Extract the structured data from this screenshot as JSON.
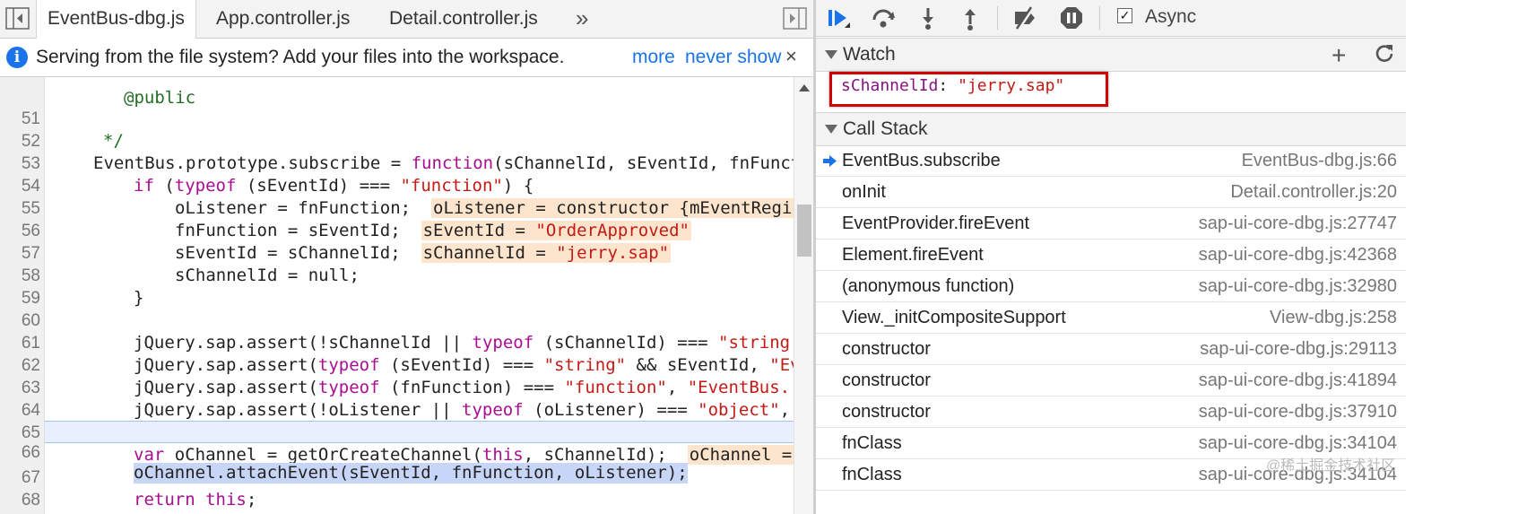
{
  "editor": {
    "tabs": [
      {
        "label": "EventBus-dbg.js",
        "active": true
      },
      {
        "label": "App.controller.js",
        "active": false
      },
      {
        "label": "Detail.controller.js",
        "active": false
      }
    ],
    "more_tabs": "»",
    "infobar": {
      "text": "Serving from the file system? Add your files into the workspace.",
      "link_more": "more",
      "link_never": "never show",
      "close": "×"
    },
    "lines": [
      {
        "n": "51"
      },
      {
        "n": "52"
      },
      {
        "n": "53"
      },
      {
        "n": "54"
      },
      {
        "n": "55"
      },
      {
        "n": "56"
      },
      {
        "n": "57"
      },
      {
        "n": "58"
      },
      {
        "n": "59"
      },
      {
        "n": "60"
      },
      {
        "n": "61"
      },
      {
        "n": "62"
      },
      {
        "n": "63"
      },
      {
        "n": "64"
      },
      {
        "n": "65"
      },
      {
        "n": "66"
      },
      {
        "n": "67"
      },
      {
        "n": "68"
      }
    ],
    "code": {
      "l50_partial": "@public",
      "l51": "*/",
      "l52_a": "EventBus.prototype.subscribe = ",
      "l52_kw": "function",
      "l52_b": "(sChannelId, sEventId, fnFunct",
      "l53_kw1": "if",
      "l53_a": " (",
      "l53_kw2": "typeof",
      "l53_b": " (sEventId) === ",
      "l53_str": "\"function\"",
      "l53_c": ") {",
      "l54": "oListener = fnFunction;",
      "l54_inline": "oListener = constructor {mEventRegi",
      "l55": "fnFunction = sEventId;",
      "l55_inline_a": "sEventId = ",
      "l55_inline_str": "\"OrderApproved\"",
      "l56": "sEventId = sChannelId;",
      "l56_inline_a": "sChannelId = ",
      "l56_inline_str": "\"jerry.sap\"",
      "l57": "sChannelId = null;",
      "l58": "}",
      "l60_a": "jQuery.sap.assert(!sChannelId || ",
      "l60_kw": "typeof",
      "l60_b": " (sChannelId) === ",
      "l60_str": "\"string",
      "l61_a": "jQuery.sap.assert(",
      "l61_kw": "typeof",
      "l61_b": " (sEventId) === ",
      "l61_str": "\"string\"",
      "l61_c": " && sEventId, ",
      "l61_str2": "\"Ev",
      "l62_a": "jQuery.sap.assert(",
      "l62_kw": "typeof",
      "l62_b": " (fnFunction) === ",
      "l62_str": "\"function\"",
      "l62_c": ", ",
      "l62_str2": "\"EventBus.",
      "l63_a": "jQuery.sap.assert(!oListener || ",
      "l63_kw": "typeof",
      "l63_b": " (oListener) === ",
      "l63_str": "\"object\"",
      "l63_c": ",",
      "l65_kw": "var",
      "l65_a": " oChannel = getOrCreateChannel(",
      "l65_kw2": "this",
      "l65_b": ", sChannelId);",
      "l65_inline": "oChannel =",
      "l66": "oChannel.attachEvent(sEventId, fnFunction, oListener);",
      "l67_kw": "return",
      "l67_kw2": "this",
      "l67_c": ";",
      "l68": "};"
    }
  },
  "debugger": {
    "async_label": "Async",
    "async_checked": true,
    "watch": {
      "title": "Watch",
      "add": "+",
      "expr_name": "sChannelId",
      "expr_colon": ": ",
      "expr_value": "\"jerry.sap\""
    },
    "callstack": {
      "title": "Call Stack",
      "frames": [
        {
          "name": "EventBus.subscribe",
          "loc": "EventBus-dbg.js:66"
        },
        {
          "name": "onInit",
          "loc": "Detail.controller.js:20"
        },
        {
          "name": "EventProvider.fireEvent",
          "loc": "sap-ui-core-dbg.js:27747"
        },
        {
          "name": "Element.fireEvent",
          "loc": "sap-ui-core-dbg.js:42368"
        },
        {
          "name": "(anonymous function)",
          "loc": "sap-ui-core-dbg.js:32980"
        },
        {
          "name": "View._initCompositeSupport",
          "loc": "View-dbg.js:258"
        },
        {
          "name": "constructor",
          "loc": "sap-ui-core-dbg.js:29113"
        },
        {
          "name": "constructor",
          "loc": "sap-ui-core-dbg.js:41894"
        },
        {
          "name": "constructor",
          "loc": "sap-ui-core-dbg.js:37910"
        },
        {
          "name": "fnClass",
          "loc": "sap-ui-core-dbg.js:34104"
        },
        {
          "name": "fnClass",
          "loc": "sap-ui-core-dbg.js:34104"
        }
      ]
    }
  },
  "watermark": "@稀土掘金技术社区",
  "colors": {
    "accent": "#1a73e8",
    "keyword": "#aa0d91",
    "string": "#c41a16",
    "highlight_frame": "#d40000"
  }
}
